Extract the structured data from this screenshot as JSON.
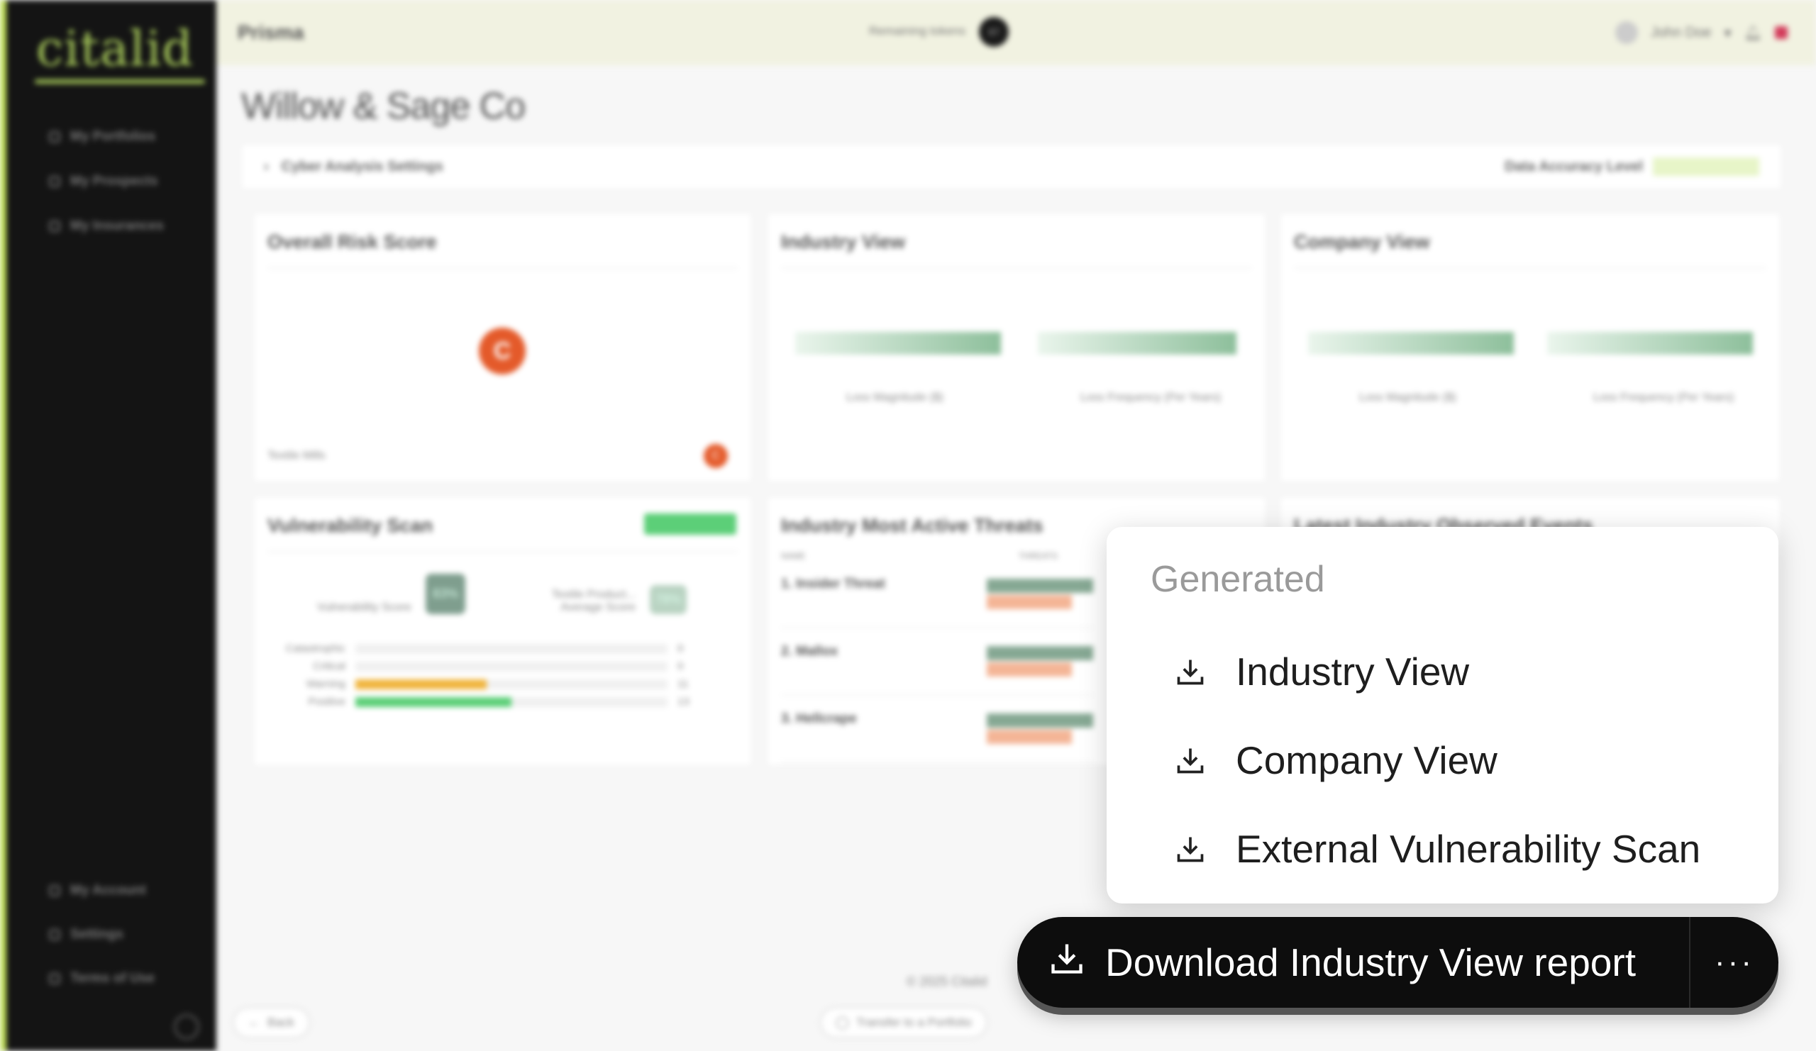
{
  "sidebar": {
    "logo": "citalid",
    "items": [
      {
        "label": "My Portfolios"
      },
      {
        "label": "My Prospects"
      },
      {
        "label": "My Insurances"
      }
    ],
    "bottom_items": [
      {
        "label": "My Account"
      },
      {
        "label": "Settings"
      },
      {
        "label": "Terms of Use"
      }
    ]
  },
  "topbar": {
    "brand": "Prisma",
    "tokens_label": "Remaining tokens",
    "tokens_value": "97",
    "user": "John Doe"
  },
  "page": {
    "title": "Willow & Sage Co",
    "settings_label": "Cyber Analysis Settings",
    "accuracy_label": "Data Accuracy Level"
  },
  "cards": {
    "risk": {
      "title": "Overall Risk Score",
      "grade": "C",
      "industry": "Textile Mills",
      "small_grade": "C"
    },
    "industry": {
      "title": "Industry View",
      "axis1": "Loss Magnitude ($)",
      "axis2": "Loss Frequency (Per Years)"
    },
    "company": {
      "title": "Company View",
      "axis1": "Loss Magnitude ($)",
      "axis2": "Loss Frequency (Per Years)"
    },
    "vuln": {
      "title": "Vulnerability Scan",
      "score_label": "Vulnerability Score",
      "score": "83%",
      "avg_label": "Textile Product... Average Score",
      "avg": "78%",
      "severities": [
        {
          "label": "Catastrophic",
          "value": "0",
          "fill": 0,
          "color": "#e0e0e0"
        },
        {
          "label": "Critical",
          "value": "0",
          "fill": 0,
          "color": "#e0e0e0"
        },
        {
          "label": "Warning",
          "value": "11",
          "fill": 0.42,
          "color": "#f0b43c"
        },
        {
          "label": "Positive",
          "value": "13",
          "fill": 0.5,
          "color": "#5ccf78"
        }
      ]
    },
    "threats": {
      "title": "Industry Most Active Threats",
      "col_name": "NAME",
      "col_threats": "THREATS",
      "rows": [
        {
          "name": "1. Insider Threat"
        },
        {
          "name": "2. Mallox"
        },
        {
          "name": "3. Hellcrape"
        }
      ]
    },
    "events": {
      "title": "Latest Industry Observed Events"
    }
  },
  "footer": {
    "back": "Back",
    "transfer": "Transfer to a Portfolio",
    "copyright": "© 2025 Citalid"
  },
  "popup": {
    "header": "Generated",
    "items": [
      {
        "label": "Industry View"
      },
      {
        "label": "Company View"
      },
      {
        "label": "External Vulnerability Scan"
      }
    ]
  },
  "cta": {
    "label": "Download Industry View report",
    "more": "···"
  }
}
